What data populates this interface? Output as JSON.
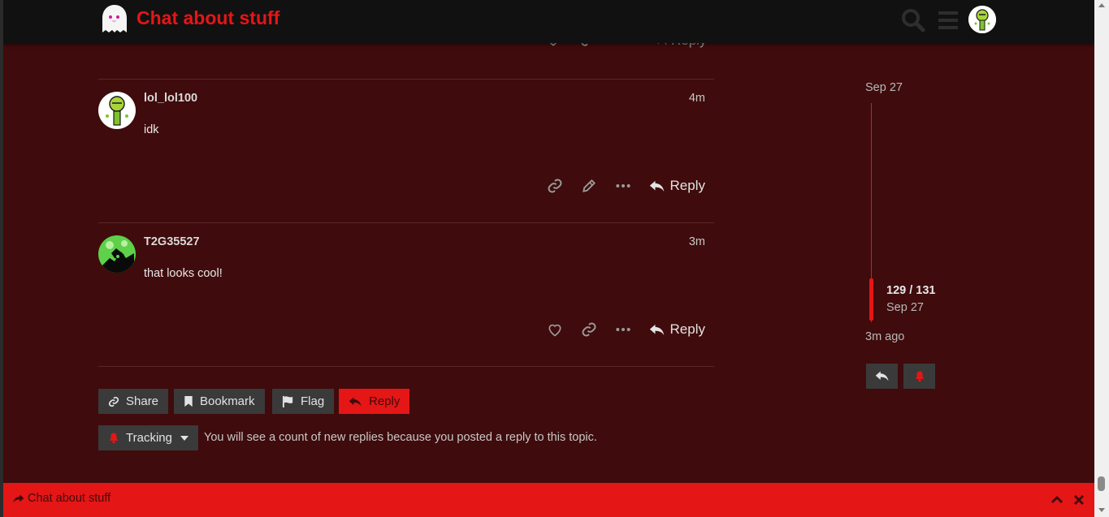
{
  "header": {
    "site_title": "Chat about stuff",
    "logo_icon": "ghost-logo",
    "search_icon": "search-icon",
    "menu_icon": "hamburger-icon",
    "user_avatar": "avatar"
  },
  "previous_post": {
    "reply_label": "Reply"
  },
  "posts": [
    {
      "username": "lol_lol100",
      "age": "4m",
      "body": "idk",
      "actions": [
        "link-icon",
        "edit-icon",
        "more-icon"
      ],
      "reply_label": "Reply"
    },
    {
      "username": "T2G35527",
      "age": "3m",
      "body": "that looks cool!",
      "actions": [
        "heart-icon",
        "link-icon",
        "more-icon"
      ],
      "reply_label": "Reply"
    }
  ],
  "timeline": {
    "start_date": "Sep 27",
    "position": "129 / 131",
    "position_date": "Sep 27",
    "last_activity": "3m ago",
    "progress_fraction": 0.985
  },
  "footer": {
    "share_label": "Share",
    "bookmark_label": "Bookmark",
    "flag_label": "Flag",
    "reply_label": "Reply",
    "tracking_label": "Tracking",
    "tracking_note": "You will see a count of new replies because you posted a reply to this topic."
  },
  "composer": {
    "title": "Chat about stuff"
  },
  "colors": {
    "accent": "#e51616",
    "background": "#3f0b0c",
    "header": "#111111",
    "button": "#3a3a3a"
  }
}
